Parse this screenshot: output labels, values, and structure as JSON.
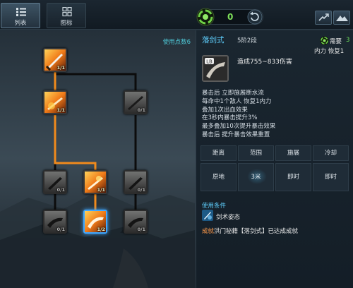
{
  "tabs": [
    {
      "label": "列表",
      "icon": "list-icon",
      "active": true
    },
    {
      "label": "图标",
      "icon": "grid-icon",
      "active": false
    }
  ],
  "skill_points": {
    "value": "0",
    "icon": "skill-point-icon"
  },
  "tree": {
    "points_used_label": "使用点数6",
    "nodes": [
      {
        "id": "n1",
        "rank": "1/1",
        "state": "active"
      },
      {
        "id": "n2",
        "rank": "1/1",
        "state": "active"
      },
      {
        "id": "n3",
        "rank": "0/1",
        "state": "locked"
      },
      {
        "id": "n4",
        "rank": "0/1",
        "state": "locked"
      },
      {
        "id": "n5",
        "rank": "1/1",
        "state": "active"
      },
      {
        "id": "n6",
        "rank": "0/1",
        "state": "locked"
      },
      {
        "id": "n7",
        "rank": "0/1",
        "state": "locked"
      },
      {
        "id": "n8",
        "rank": "1/2",
        "state": "selected"
      },
      {
        "id": "n9",
        "rank": "0/1",
        "state": "locked"
      }
    ]
  },
  "detail": {
    "name": "落剑式",
    "stage": "5阶2段",
    "need_label": "需要",
    "need_value": "3",
    "cost": "内力 恢复1",
    "icon_badge": "LB",
    "effect": "造成755~833伤害",
    "description": [
      "暴击后 立即施展断水流",
      "每命中1个敌人 恢复1内力",
      "叠加1次出血效果",
      "在3秒内暴击提升3%",
      "最多叠加10次提升暴击效果",
      "暴击后 提升暴击效果重置"
    ],
    "table_headers": [
      "距离",
      "范围",
      "施展",
      "冷却"
    ],
    "table_values": [
      "原地",
      "3米",
      "即时",
      "即时"
    ],
    "condition_title": "使用条件",
    "condition_text": "剑术姿态",
    "achievement_tag": "成就",
    "achievement_text": "洪门秘籍【落剑式】已达成成就"
  },
  "colors": {
    "accent_blue": "#5fd0ff",
    "points_green": "#7ee05a",
    "active_line": "#f08a1c",
    "inactive_line": "#111111",
    "achievement_orange": "#ff9a4a"
  }
}
